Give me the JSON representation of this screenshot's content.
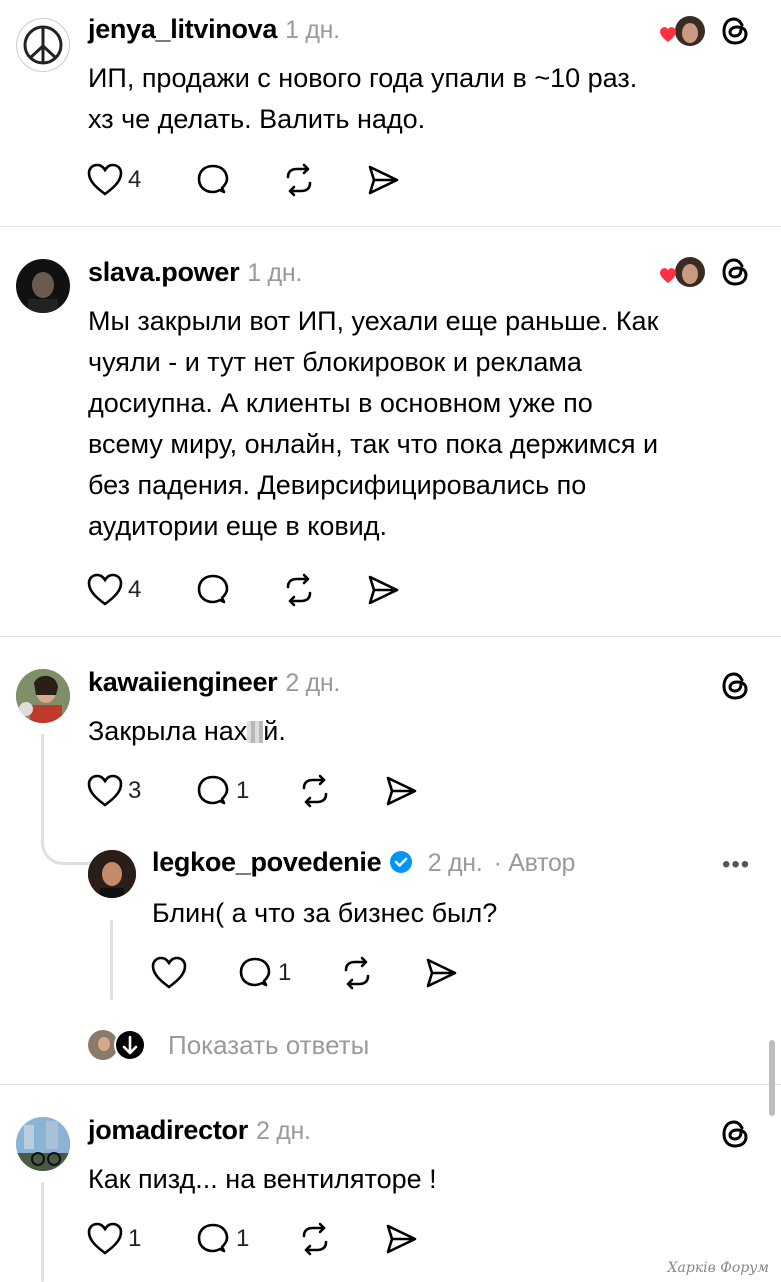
{
  "posts": [
    {
      "username": "jenya_litvinova",
      "time": "1 дн.",
      "lines": [
        "ИП, продажи с нового года упали в ~10 раз.",
        "хз че делать. Валить надо."
      ],
      "likes": "4"
    },
    {
      "username": "slava.power",
      "time": "1 дн.",
      "lines": [
        "Мы закрыли вот ИП, уехали еще раньше. Как",
        "чуяли - и тут нет блокировок и реклама",
        "досиупна. А клиенты в основном уже по",
        "всему миру, онлайн, так что пока держимся и",
        "без падения. Девирсифицировались по",
        "аудитории еще в ковид."
      ],
      "likes": "4"
    },
    {
      "username": "kawaiiengineer",
      "time": "2 дн.",
      "text_before": "Закрыла нах",
      "text_after": "й.",
      "likes": "3",
      "comments": "1"
    },
    {
      "username": "legkoe_povedenie",
      "time": "2 дн.",
      "author_label": "· Автор",
      "text": "Блин( а что за бизнес был?",
      "comments": "1"
    },
    {
      "username": "jomadirector",
      "time": "2 дн.",
      "text": "Как пизд... на вентиляторе !",
      "likes": "1",
      "comments": "1"
    }
  ],
  "show_replies": "Показать ответы",
  "more_menu": "•••",
  "watermark": "Харків Форум",
  "colors": {
    "heart": "#ff3040",
    "verified": "#0095f6",
    "muted": "#9a9a9a",
    "divider": "#e3e3e3"
  }
}
